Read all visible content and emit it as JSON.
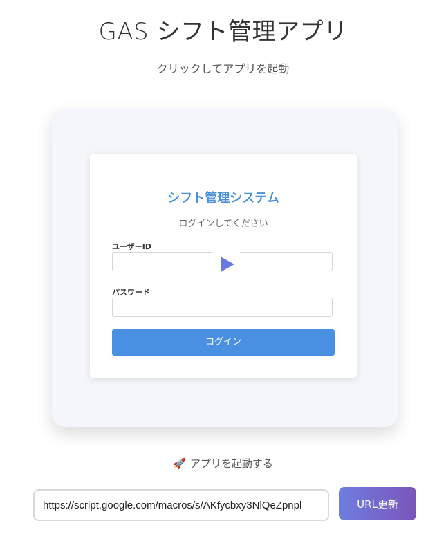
{
  "header": {
    "title": "GAS シフト管理アプリ",
    "subtitle": "クリックしてアプリを起動"
  },
  "preview": {
    "login_title": "シフト管理システム",
    "login_subtitle": "ログインしてください",
    "user_id_label": "ユーザーID",
    "password_label": "パスワード",
    "login_button": "ログイン",
    "play_icon": "play-icon"
  },
  "launch": {
    "icon": "rocket-icon",
    "label": "アプリを起動する"
  },
  "url_bar": {
    "value": "https://script.google.com/macros/s/AKfycbxy3NlQeZpnpl",
    "button_label": "URL更新"
  },
  "colors": {
    "accent_blue": "#4a90e2",
    "play_purple": "#6778e0",
    "button_gradient_start": "#6f7de0",
    "button_gradient_end": "#7a55b8"
  }
}
